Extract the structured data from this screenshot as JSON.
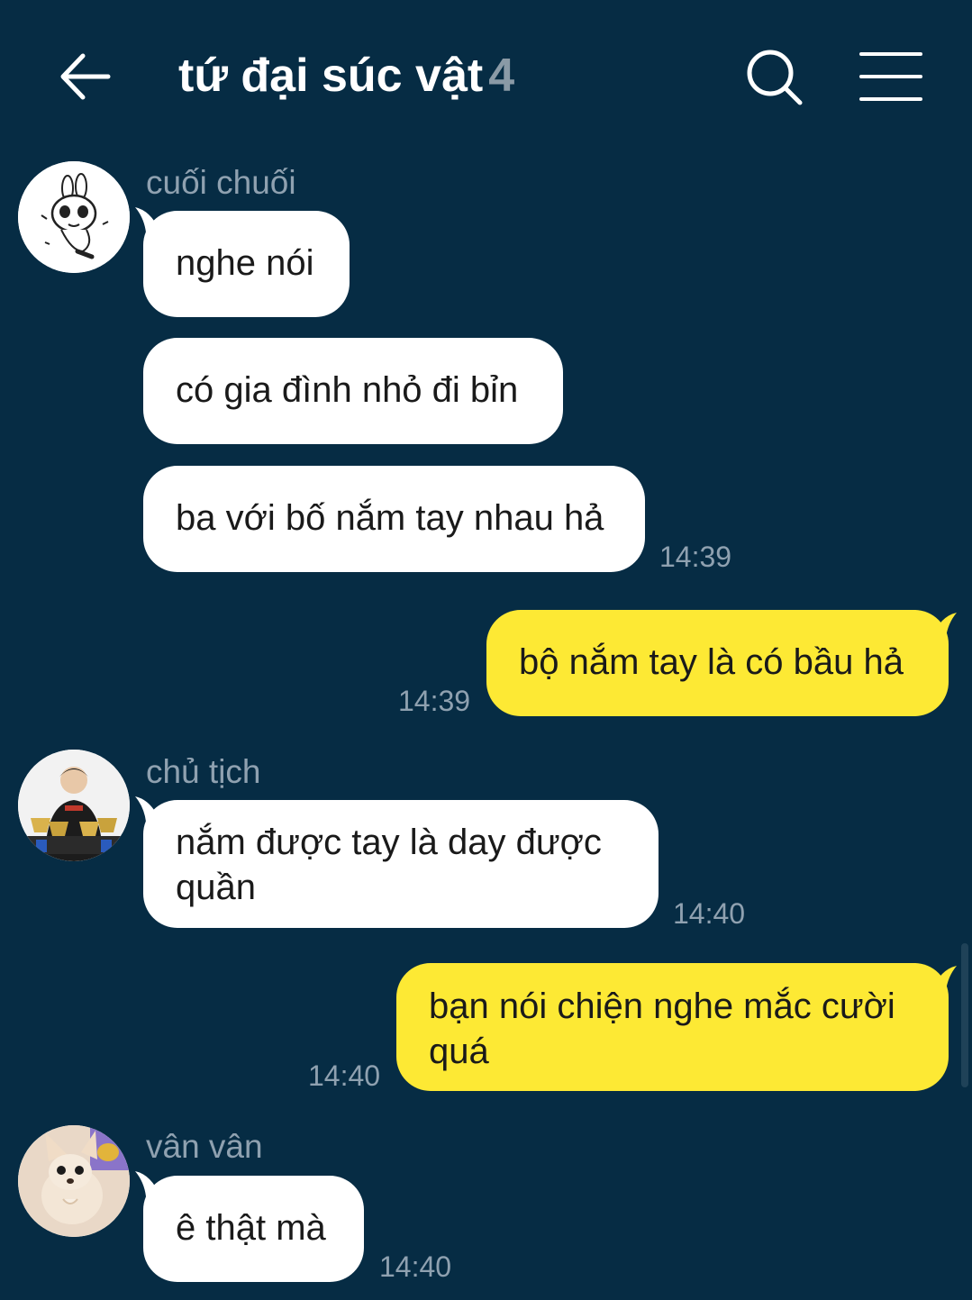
{
  "header": {
    "back_icon": "arrow-left-icon",
    "title": "tứ đại súc vật",
    "member_count": "4",
    "search_icon": "search-icon",
    "menu_icon": "hamburger-menu-icon"
  },
  "colors": {
    "background": "#062c44",
    "incoming_bubble": "#ffffff",
    "outgoing_bubble": "#fde934",
    "meta_text": "#8fa1b0"
  },
  "messages": [
    {
      "sender": "cuối chuối",
      "avatar": "bunny-sticker-avatar",
      "texts": [
        "nghe nói",
        "có gia đình nhỏ đi bỉn",
        "ba với bố nắm tay nhau hả"
      ],
      "time": "14:39"
    },
    {
      "outgoing": true,
      "texts": [
        "bộ nắm tay là có bầu hả"
      ],
      "time": "14:39"
    },
    {
      "sender": "chủ tịch",
      "avatar": "man-with-trophies-avatar",
      "texts": [
        "nắm được tay là day được quần"
      ],
      "time": "14:40"
    },
    {
      "outgoing": true,
      "texts": [
        "bạn nói chiện nghe mắc cười quá"
      ],
      "time": "14:40"
    },
    {
      "sender": "vân vân",
      "avatar": "chihuahua-avatar",
      "texts": [
        "ê thật mà"
      ],
      "time": "14:40"
    }
  ]
}
